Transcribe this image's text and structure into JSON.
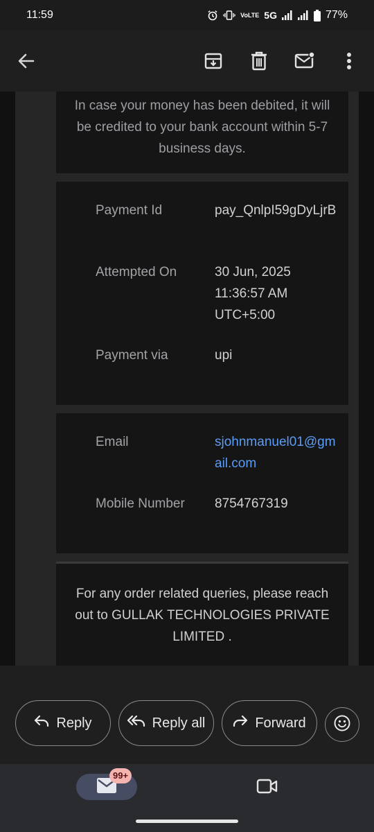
{
  "status_bar": {
    "time": "11:59",
    "network": "5G",
    "volte": "VoLTE",
    "battery": "77%",
    "icons": [
      "alarm-icon",
      "vibrate-icon",
      "volte-icon",
      "signal-icon",
      "signal-icon",
      "battery-icon"
    ]
  },
  "app_bar": {
    "icons": [
      "back-arrow-icon",
      "archive-icon",
      "delete-icon",
      "mark-unread-icon",
      "more-vert-icon"
    ]
  },
  "email": {
    "notice": "In case your money has been debited, it will be credited to your bank account within 5-7 business days.",
    "details": [
      {
        "label": "Payment Id",
        "value": "pay_QnlpI59gDyLjrB"
      },
      {
        "label": "Attempted On",
        "value": "30 Jun, 2025 11:36:57 AM UTC+5:00"
      },
      {
        "label": "Payment via",
        "value": "upi"
      }
    ],
    "contact": [
      {
        "label": "Email",
        "value": "sjohnmanuel01@gmail.com"
      },
      {
        "label": "Mobile Number",
        "value": "8754767319"
      }
    ],
    "footer": "For any order related queries, please reach out to GULLAK TECHNOLOGIES PRIVATE LIMITED ."
  },
  "actions": {
    "reply": "Reply",
    "reply_all": "Reply all",
    "forward": "Forward"
  },
  "bottom_nav": {
    "mail_badge": "99+"
  },
  "colors": {
    "link": "#5a9df7",
    "badge_bg": "#f6b4b1",
    "nav_active_bg": "#464d63"
  }
}
